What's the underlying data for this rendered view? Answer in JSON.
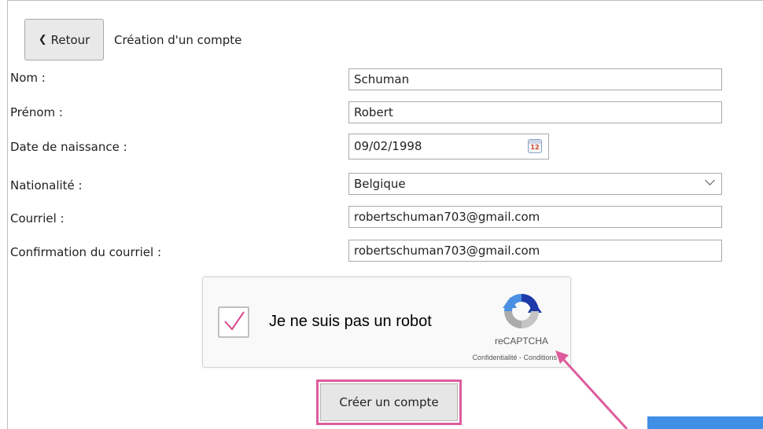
{
  "header": {
    "back_label": "Retour",
    "back_glyph": "❮",
    "title": "Création d'un compte"
  },
  "form": {
    "nom": {
      "label": "Nom :",
      "value": "Schuman"
    },
    "prenom": {
      "label": "Prénom :",
      "value": "Robert"
    },
    "date_naissance": {
      "label": "Date de naissance :",
      "value": "09/02/1998",
      "calendar_num": "12"
    },
    "nationalite": {
      "label": "Nationalité :",
      "value": "Belgique"
    },
    "courriel": {
      "label": "Courriel :",
      "value": "robertschuman703@gmail.com"
    },
    "confirmation": {
      "label": "Confirmation du courriel :",
      "value": "robertschuman703@gmail.com"
    }
  },
  "recaptcha": {
    "label": "Je ne suis pas un robot",
    "brand": "reCAPTCHA",
    "terms": "Confidentialité - Conditions",
    "checked": true
  },
  "submit": {
    "label": "Créer un compte"
  },
  "colors": {
    "highlight": "#de5c9d",
    "check": "#d9498f",
    "corner_block": "#3f8fe6"
  },
  "icons": {
    "back": "chevron-left-icon",
    "calendar": "calendar-icon",
    "select": "chevron-down-icon",
    "recaptcha": "recaptcha-logo-icon",
    "check": "checkmark-icon",
    "annotation": "arrow-annotation"
  }
}
